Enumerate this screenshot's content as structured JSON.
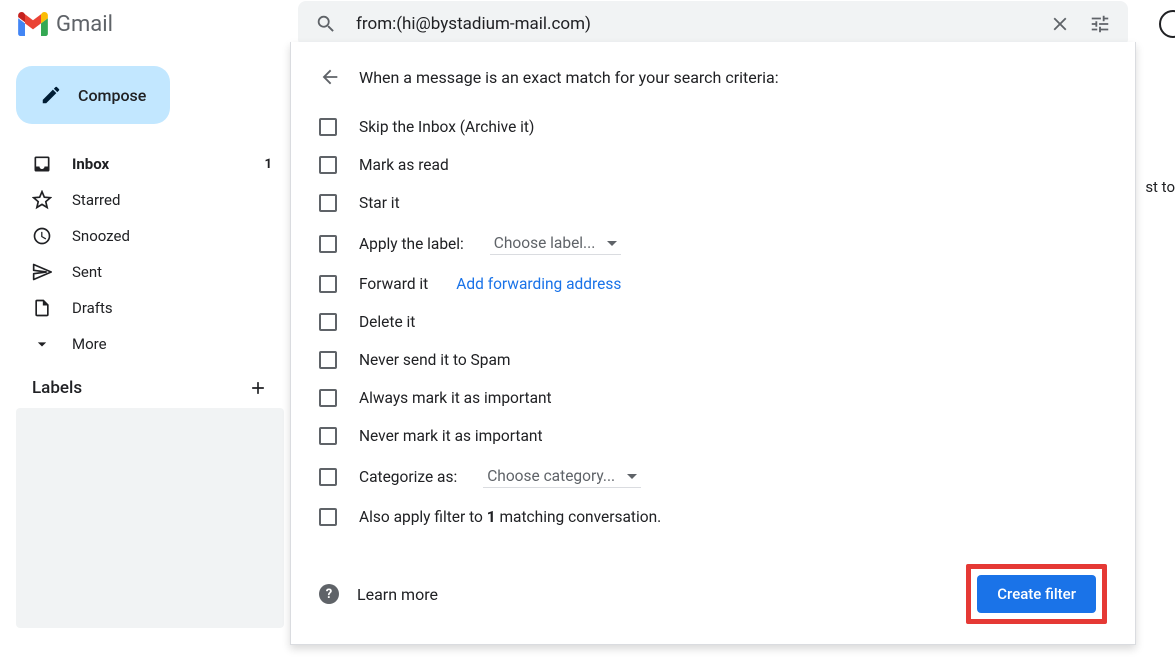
{
  "header": {
    "app_name": "Gmail",
    "search_value": "from:(hi@bystadium-mail.com)"
  },
  "sidebar": {
    "compose_label": "Compose",
    "items": [
      {
        "label": "Inbox",
        "count": "1"
      },
      {
        "label": "Starred"
      },
      {
        "label": "Snoozed"
      },
      {
        "label": "Sent"
      },
      {
        "label": "Drafts"
      },
      {
        "label": "More"
      }
    ],
    "labels_heading": "Labels"
  },
  "filter_panel": {
    "heading": "When a message is an exact match for your search criteria:",
    "options": {
      "skip_inbox": "Skip the Inbox (Archive it)",
      "mark_read": "Mark as read",
      "star_it": "Star it",
      "apply_label_text": "Apply the label:",
      "apply_label_choose": "Choose label...",
      "forward_text": "Forward it",
      "forward_link": "Add forwarding address",
      "delete_it": "Delete it",
      "never_spam": "Never send it to Spam",
      "always_important": "Always mark it as important",
      "never_important": "Never mark it as important",
      "categorize_text": "Categorize as:",
      "categorize_choose": "Choose category...",
      "also_apply_pre": "Also apply filter to ",
      "also_apply_count": "1",
      "also_apply_post": " matching conversation."
    },
    "learn_more": "Learn more",
    "create_button": "Create filter"
  },
  "background": {
    "partial_text": "st to"
  }
}
